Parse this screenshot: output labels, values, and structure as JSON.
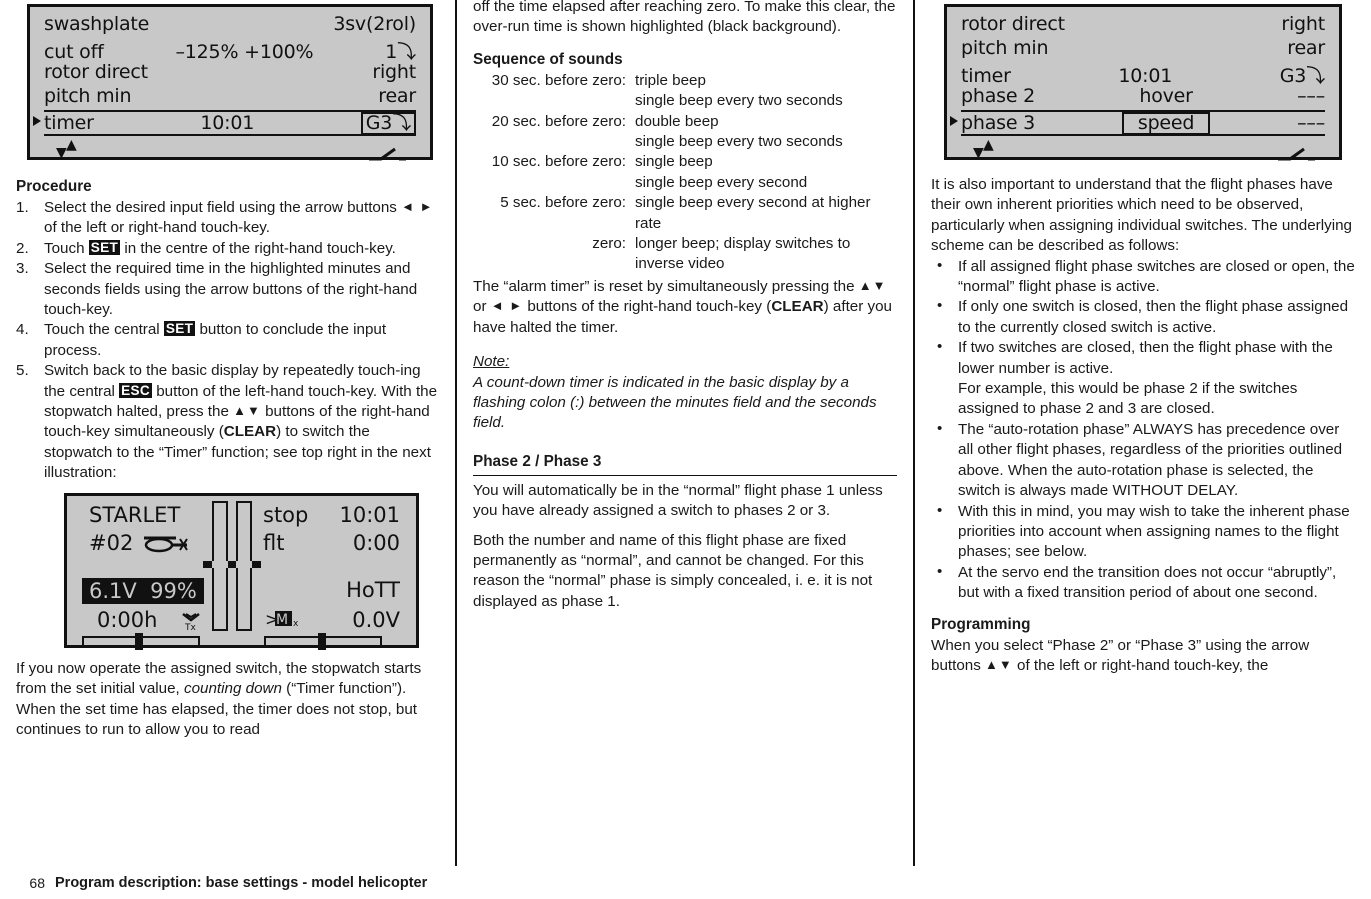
{
  "footer": {
    "page_number": "68",
    "title": "Program description: base settings - model helicopter"
  },
  "lcd_top_left": {
    "rows": [
      {
        "label": "swashplate",
        "mid": "",
        "right": "3sv(2rol)"
      },
      {
        "label": "cut off",
        "mid": "–125%  +100%",
        "right": "1⤵"
      },
      {
        "label": "rotor direct",
        "mid": "",
        "right": "right"
      },
      {
        "label": "pitch min",
        "mid": "",
        "right": "rear"
      },
      {
        "label": "timer",
        "mid": "10:01",
        "right": "G3⤵",
        "selected": true,
        "boxed_right": true
      }
    ]
  },
  "lcd_top_right": {
    "rows": [
      {
        "label": "rotor direct",
        "mid": "",
        "right": "right"
      },
      {
        "label": "pitch min",
        "mid": "",
        "right": "rear"
      },
      {
        "label": "timer",
        "mid": "10:01",
        "right": "G3⤵"
      },
      {
        "label": "phase  2",
        "mid": "hover",
        "right": "–––"
      },
      {
        "label": "phase  3",
        "mid": "speed",
        "right": "–––",
        "selected": true,
        "boxed_mid": true
      }
    ]
  },
  "lcd_basic": {
    "model_name": "STARLET",
    "memory_slot": "#02",
    "timer_mode": "stop",
    "timer_value": "10:01",
    "flight_label": "flt",
    "flight_value": "0:00",
    "battery_voltage": "6.1V",
    "battery_percent": "99%",
    "operating_hours": "0:00h",
    "system_label": "HoTT",
    "rx_voltage": "0.0V"
  },
  "col1": {
    "heading_procedure": "Procedure",
    "steps": [
      {
        "num": "1.",
        "parts": [
          {
            "t": "Select the desired input field using the arrow buttons "
          },
          {
            "t": "◄ ►",
            "style": "arrows"
          },
          {
            "t": " of the left or right-hand touch-key."
          }
        ]
      },
      {
        "num": "2.",
        "parts": [
          {
            "t": "Touch "
          },
          {
            "t": "SET",
            "style": "key"
          },
          {
            "t": " in the centre of the right-hand touch-key."
          }
        ]
      },
      {
        "num": "3.",
        "parts": [
          {
            "t": "Select the required time in the highlighted minutes and seconds fields using the arrow buttons of the right-hand touch-key."
          }
        ]
      },
      {
        "num": "4.",
        "parts": [
          {
            "t": "Touch the central "
          },
          {
            "t": "SET",
            "style": "key"
          },
          {
            "t": " button to conclude the input process."
          }
        ]
      },
      {
        "num": "5.",
        "parts": [
          {
            "t": "Switch back to the basic display by repeatedly touch-ing the central "
          },
          {
            "t": "ESC",
            "style": "key"
          },
          {
            "t": " button of the left-hand touch-key. With the stopwatch halted, press the "
          },
          {
            "t": "▲▼",
            "style": "arrows"
          },
          {
            "t": " buttons of the right-hand touch-key simultaneously ("
          },
          {
            "t": "CLEAR",
            "style": "bold"
          },
          {
            "t": ") to switch the stopwatch to the “Timer” function; see top right in the next illustration:"
          }
        ]
      }
    ],
    "closing_parts": [
      {
        "t": "If you now operate the assigned switch, the stopwatch starts from the set initial value, "
      },
      {
        "t": "counting down",
        "style": "ital"
      },
      {
        "t": " (“Timer function”). When the set time has elapsed, the timer does not stop, but continues to run to allow you to read"
      }
    ]
  },
  "col2": {
    "intro": "off the time elapsed after reaching zero. To make this clear, the over-run time is shown highlighted (black background).",
    "heading_sounds": "Sequence of sounds",
    "sounds": [
      {
        "when": "30 sec. before zero:",
        "what": "triple beep"
      },
      {
        "when": "",
        "what": "single beep every two seconds"
      },
      {
        "when": "20 sec. before zero:",
        "what": "double beep"
      },
      {
        "when": "",
        "what": "single beep every two seconds"
      },
      {
        "when": "10 sec. before zero:",
        "what": "single beep"
      },
      {
        "when": "",
        "what": "single beep every second"
      },
      {
        "when": "5 sec. before zero:",
        "what": "single beep every second at higher rate"
      },
      {
        "when": "zero:",
        "what": "longer beep; display switches to inverse video"
      }
    ],
    "reset_parts": [
      {
        "t": "The “alarm timer” is reset by simultaneously pressing the "
      },
      {
        "t": "▲▼",
        "style": "arrows"
      },
      {
        "t": " or "
      },
      {
        "t": "◄ ►",
        "style": "arrows"
      },
      {
        "t": " buttons of the right-hand touch-key ("
      },
      {
        "t": "CLEAR",
        "style": "bold"
      },
      {
        "t": ") after you have halted the timer."
      }
    ],
    "note_label": "Note:",
    "note_text": "A count-down timer is indicated in the basic display by a flashing colon (:) between the minutes field and the seconds field.",
    "heading_phase": "Phase 2 / Phase 3",
    "phase_p1": "You will automatically be in the “normal” flight phase 1 unless you have already assigned a switch to phases 2 or 3.",
    "phase_p2": "Both the number and name of this flight phase are fixed permanently as “normal”, and cannot be changed. For this reason the “normal” phase is simply concealed, i. e. it is not displayed as phase 1."
  },
  "col3": {
    "intro": "It is also important to understand that the flight phases have their own inherent priorities which need to be observed, particularly when assigning individual switches. The underlying scheme can be described as follows:",
    "bullets": [
      {
        "text": "If all assigned flight phase switches are closed or open, the “normal” flight phase is active."
      },
      {
        "text": "If only one switch is closed, then the flight phase assigned to the currently closed switch is active."
      },
      {
        "text": "If two switches are closed, then the flight phase with the lower number is active.",
        "sub": "For example, this would be phase 2 if the switches assigned to phase 2 and 3 are closed."
      },
      {
        "text": "The “auto-rotation phase” ALWAYS has precedence over all other flight phases, regardless of the priorities outlined above. When the auto-rotation phase is selected, the switch is always made WITHOUT DELAY."
      },
      {
        "text": "With this in mind, you may wish to take the inherent phase priorities into account when assigning names to the flight phases; see below."
      },
      {
        "text": "At the servo end the transition does not occur “abruptly”, but with a fixed transition period of about one second."
      }
    ],
    "heading_programming": "Programming",
    "programming_parts": [
      {
        "t": "When you select “Phase 2” or “Phase 3” using the arrow buttons "
      },
      {
        "t": "▲▼",
        "style": "arrows"
      },
      {
        "t": " of the left or right-hand touch-key, the"
      }
    ]
  }
}
